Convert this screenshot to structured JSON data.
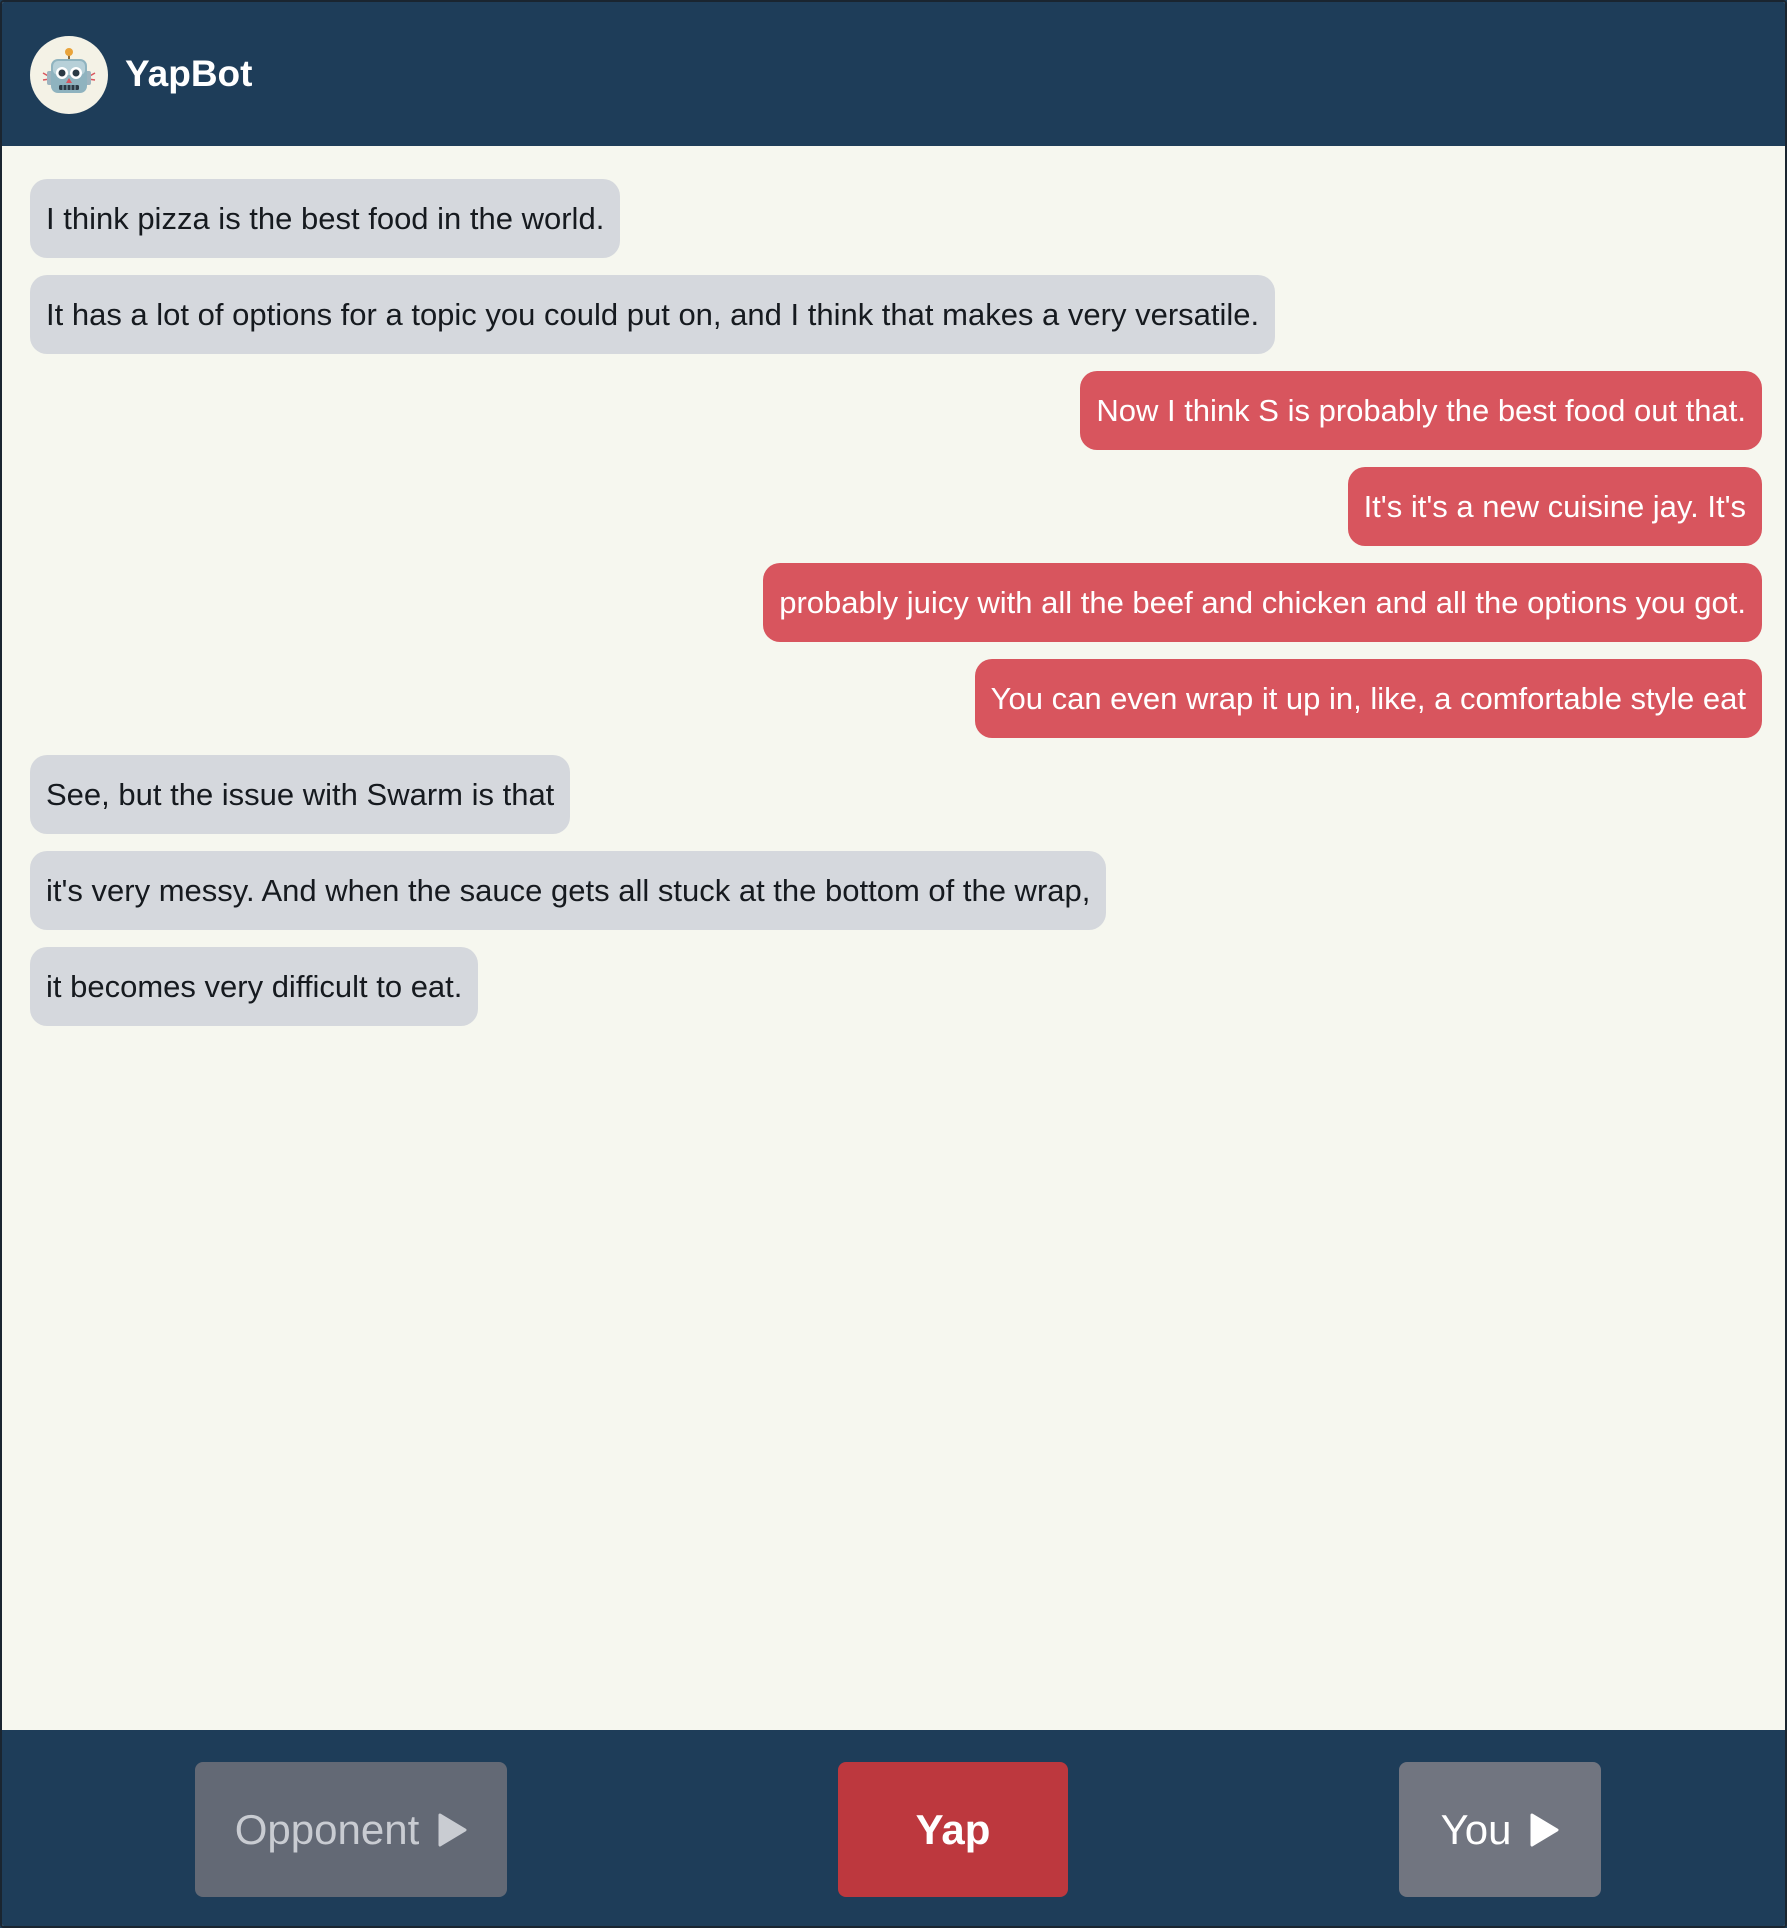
{
  "header": {
    "title": "YapBot",
    "avatar_icon": "robot-icon"
  },
  "colors": {
    "header_bg": "#1e3d59",
    "chat_bg": "#f6f7ef",
    "opponent_bubble": "#d5d8dd",
    "you_bubble": "#d8555e",
    "yap_button": "#bd383e",
    "opponent_button": "#636975",
    "you_button": "#717580"
  },
  "messages": [
    {
      "sender": "opponent",
      "text": "I think pizza is the best food in the world."
    },
    {
      "sender": "opponent",
      "text": "It has a lot of options for a topic you could put on, and I think that makes a very versatile."
    },
    {
      "sender": "you",
      "text": "Now I think S is probably the best food out that."
    },
    {
      "sender": "you",
      "text": "It's it's a new cuisine jay. It's"
    },
    {
      "sender": "you",
      "text": "probably juicy with all the beef and chicken and all the options you got."
    },
    {
      "sender": "you",
      "text": "You can even wrap it up in, like, a comfortable style eat"
    },
    {
      "sender": "opponent",
      "text": "See, but the issue with Swarm is that"
    },
    {
      "sender": "opponent",
      "text": "it's very messy. And when the sauce gets all stuck at the bottom of the wrap,"
    },
    {
      "sender": "opponent",
      "text": "it becomes very difficult to eat."
    }
  ],
  "footer": {
    "opponent_label": "Opponent",
    "yap_label": "Yap",
    "you_label": "You",
    "play_icon": "play-icon"
  }
}
